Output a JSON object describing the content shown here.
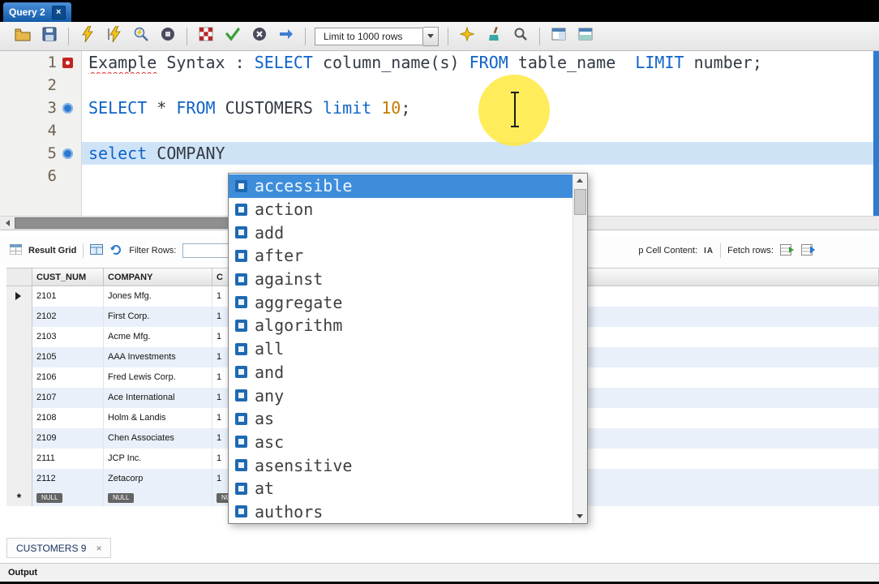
{
  "titlebar": {
    "tab_label": "Query 2",
    "close_glyph": "×"
  },
  "toolbar": {
    "limit_label": "Limit to 1000 rows"
  },
  "editor": {
    "lines": [
      {
        "num": "1",
        "marker": "error",
        "current": false,
        "segments": [
          {
            "t": "Example",
            "c": "plain squiggle"
          },
          {
            "t": " Syntax : ",
            "c": "plain"
          },
          {
            "t": "SELECT",
            "c": "kw"
          },
          {
            "t": " column_name(s) ",
            "c": "plain"
          },
          {
            "t": "FROM",
            "c": "kw"
          },
          {
            "t": " table_name  ",
            "c": "plain"
          },
          {
            "t": "LIMIT",
            "c": "kw"
          },
          {
            "t": " number;",
            "c": "plain"
          }
        ]
      },
      {
        "num": "2",
        "marker": "",
        "current": false,
        "segments": []
      },
      {
        "num": "3",
        "marker": "stmt",
        "current": false,
        "segments": [
          {
            "t": "SELECT",
            "c": "kw"
          },
          {
            "t": " * ",
            "c": "plain"
          },
          {
            "t": "FROM",
            "c": "kw"
          },
          {
            "t": " CUSTOMERS ",
            "c": "plain"
          },
          {
            "t": "limit",
            "c": "kw"
          },
          {
            "t": " ",
            "c": "plain"
          },
          {
            "t": "10",
            "c": "num"
          },
          {
            "t": ";",
            "c": "plain"
          }
        ]
      },
      {
        "num": "4",
        "marker": "",
        "current": false,
        "segments": []
      },
      {
        "num": "5",
        "marker": "stmt",
        "current": true,
        "segments": [
          {
            "t": "select",
            "c": "kw"
          },
          {
            "t": " COMPANY",
            "c": "plain"
          }
        ]
      },
      {
        "num": "6",
        "marker": "",
        "current": false,
        "segments": []
      }
    ]
  },
  "autocomplete": {
    "selected_index": 0,
    "items": [
      "accessible",
      "action",
      "add",
      "after",
      "against",
      "aggregate",
      "algorithm",
      "all",
      "and",
      "any",
      "as",
      "asc",
      "asensitive",
      "at",
      "authors"
    ]
  },
  "result_grid": {
    "toolbar_left": {
      "title": "Result Grid",
      "filter_label": "Filter Rows:",
      "filter_value": ""
    },
    "toolbar_right": {
      "wrap_label": "p Cell Content:",
      "wrap_icon": "IA",
      "fetch_label": "Fetch rows:"
    },
    "columns": [
      "CUST_NUM",
      "COMPANY",
      "C"
    ],
    "rows": [
      [
        "2101",
        "Jones Mfg.",
        "1"
      ],
      [
        "2102",
        "First Corp.",
        "1"
      ],
      [
        "2103",
        "Acme Mfg.",
        "1"
      ],
      [
        "2105",
        "AAA Investments",
        "1"
      ],
      [
        "2106",
        "Fred Lewis Corp.",
        "1"
      ],
      [
        "2107",
        "Ace International",
        "1"
      ],
      [
        "2108",
        "Holm & Landis",
        "1"
      ],
      [
        "2109",
        "Chen Associates",
        "1"
      ],
      [
        "2111",
        "JCP Inc.",
        "1"
      ],
      [
        "2112",
        "Zetacorp",
        "1"
      ]
    ],
    "null_badge": "NULL",
    "new_row_glyph": "*"
  },
  "bottom": {
    "result_tab": "CUSTOMERS 9",
    "close_glyph": "×",
    "output_title": "Output"
  },
  "colors": {
    "accent": "#1259a8",
    "highlight": "#ffe93d",
    "selection": "#3e8ddb",
    "keyword": "#0e63c9"
  }
}
